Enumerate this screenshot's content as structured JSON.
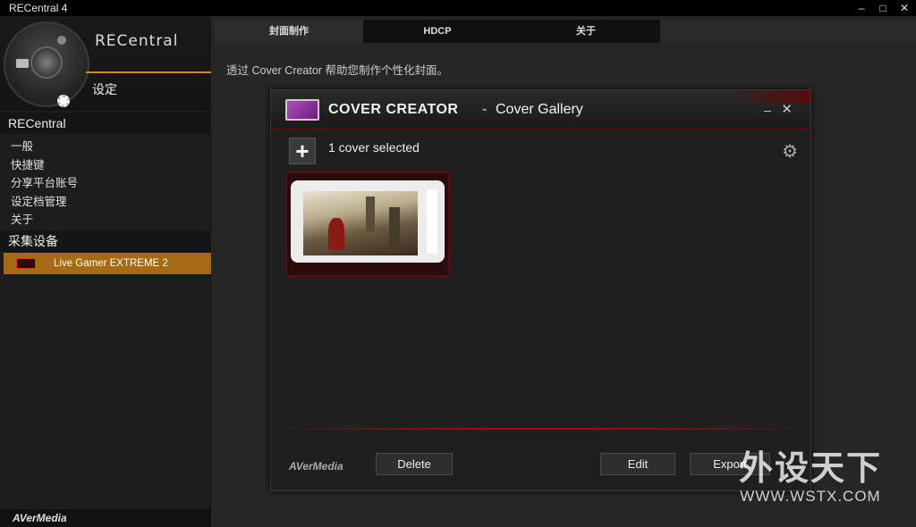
{
  "window": {
    "title": "RECentral 4",
    "minimize_icon": "minimize-icon",
    "maximize_icon": "maximize-icon",
    "close_icon": "close-icon"
  },
  "sidebar": {
    "brand": "RECentral",
    "settings_label": "设定",
    "section_recentral": "RECentral",
    "items": [
      {
        "label": "一般"
      },
      {
        "label": "快捷键"
      },
      {
        "label": "分享平台账号"
      },
      {
        "label": "设定档管理"
      },
      {
        "label": "关于"
      }
    ],
    "section_devices": "采集设备",
    "device": {
      "label": "Live Gamer EXTREME 2"
    },
    "footer_logo": "AVerMedia"
  },
  "tabs": [
    {
      "label": "封面制作",
      "active": true
    },
    {
      "label": "HDCP",
      "active": false
    },
    {
      "label": "关于",
      "active": false
    }
  ],
  "main": {
    "description": "透过 Cover Creator 帮助您制作个性化封面。"
  },
  "cover_creator": {
    "title": "COVER CREATOR",
    "separator": "-",
    "subtitle": "Cover Gallery",
    "minimize": "–",
    "close": "✕",
    "add": "+",
    "selected_text": "1 cover selected",
    "settings_icon": "⚙",
    "footer_logo": "AVerMedia",
    "buttons": {
      "delete": "Delete",
      "edit": "Edit",
      "export": "Export"
    }
  },
  "watermark": {
    "text_cn": "外设天下",
    "text_url": "WWW.WSTX.COM"
  },
  "colors": {
    "accent_orange": "#a66a15",
    "accent_red": "#a01010",
    "background": "#262626"
  }
}
